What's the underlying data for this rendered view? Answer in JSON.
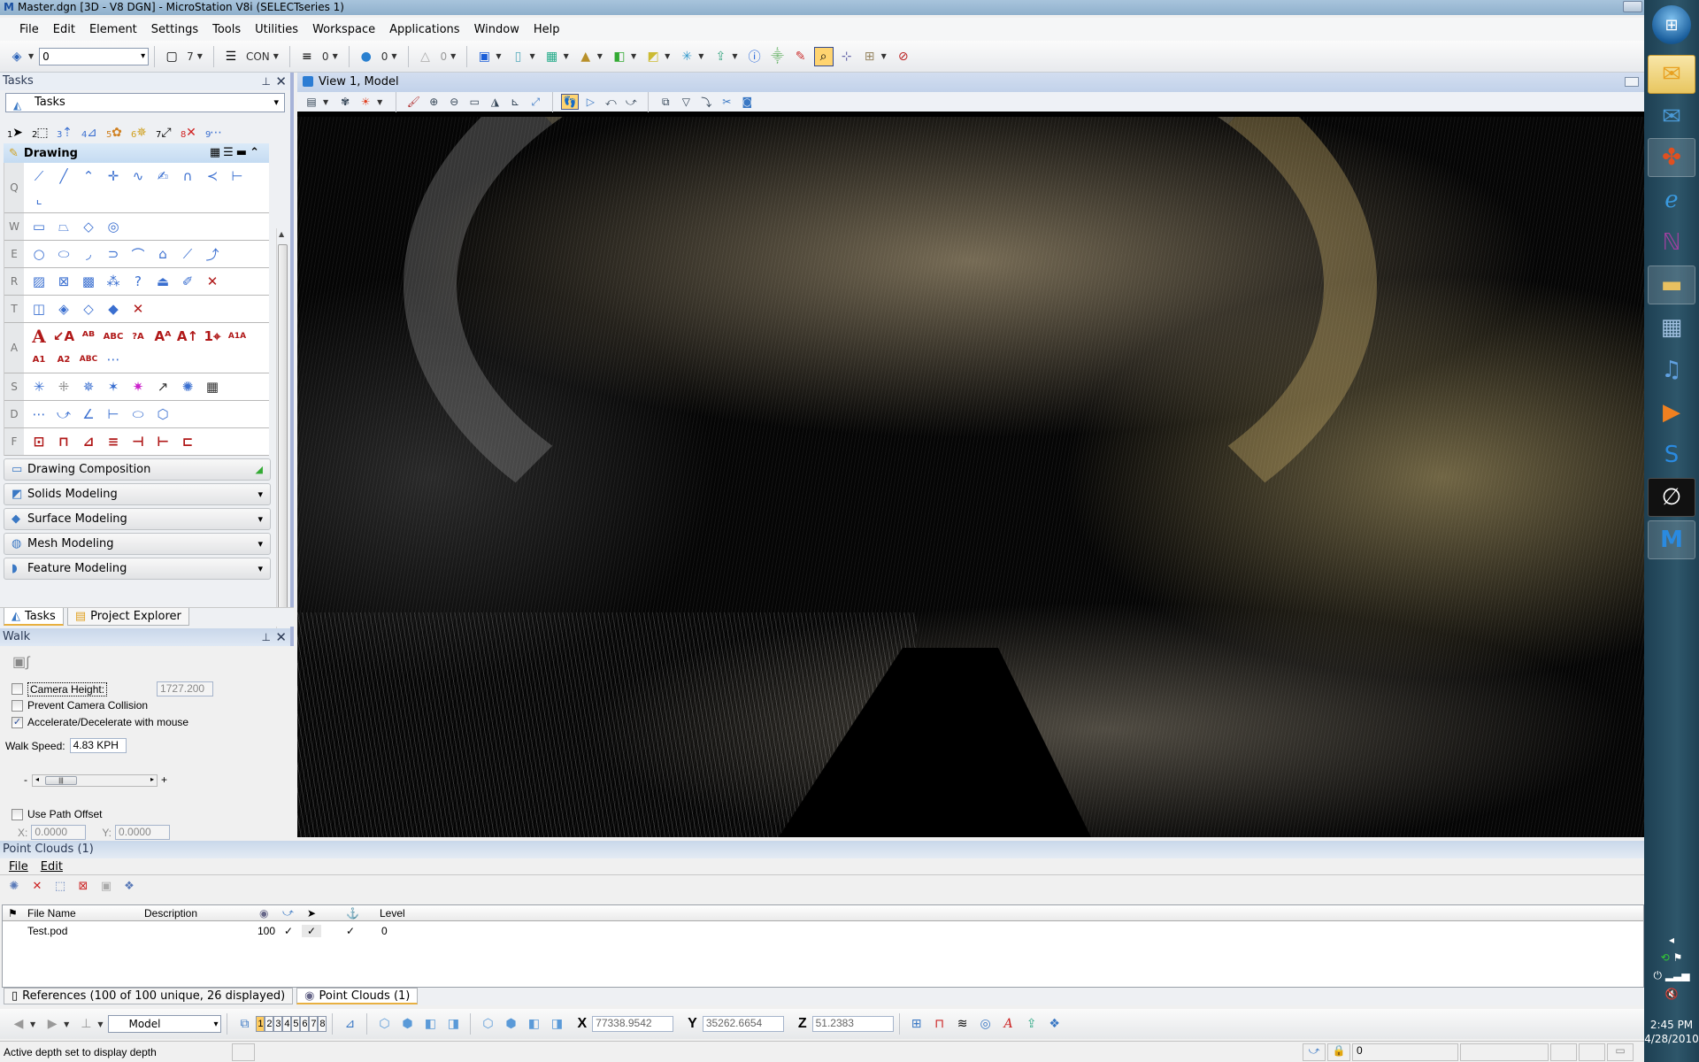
{
  "window": {
    "title": "Master.dgn [3D - V8 DGN] - MicroStation V8i (SELECTseries 1)"
  },
  "menu": [
    "File",
    "Edit",
    "Element",
    "Settings",
    "Tools",
    "Utilities",
    "Workspace",
    "Applications",
    "Window",
    "Help"
  ],
  "attributes_toolbar": {
    "active_level": "0",
    "color_value": "7",
    "line_style_value": "CON",
    "line_weight_value": "0",
    "transparency_value": "0",
    "priority_value": "0"
  },
  "tasks_panel": {
    "title": "Tasks",
    "combo_value": "Tasks",
    "quick_tools": [
      "1",
      "2",
      "3",
      "4",
      "5",
      "6",
      "7",
      "8",
      "9"
    ],
    "drawing_header": "Drawing",
    "row_keys": [
      "Q",
      "W",
      "E",
      "R",
      "T",
      "A",
      "S",
      "D",
      "F"
    ],
    "categories": [
      {
        "label": "Drawing Composition",
        "icon": "drawing-composition-icon"
      },
      {
        "label": "Solids Modeling",
        "icon": "solids-modeling-icon"
      },
      {
        "label": "Surface Modeling",
        "icon": "surface-modeling-icon"
      },
      {
        "label": "Mesh Modeling",
        "icon": "mesh-modeling-icon"
      },
      {
        "label": "Feature Modeling",
        "icon": "feature-modeling-icon"
      }
    ],
    "tabs": [
      {
        "label": "Tasks",
        "active": true
      },
      {
        "label": "Project Explorer",
        "active": false
      }
    ]
  },
  "walk_panel": {
    "title": "Walk",
    "camera_height_label": "Camera Height:",
    "camera_height_checked": false,
    "camera_height_value": "1727.200",
    "prevent_collision_label": "Prevent Camera Collision",
    "prevent_collision_checked": false,
    "accelerate_label": "Accelerate/Decelerate with mouse",
    "accelerate_checked": true,
    "walk_speed_label": "Walk Speed:",
    "walk_speed_value": "4.83 KPH",
    "slider_minus": "-",
    "slider_plus": "+",
    "path_offset_label": "Use Path Offset",
    "path_offset_checked": false,
    "x_label": "X:",
    "x_value": "0.0000",
    "y_label": "Y:",
    "y_value": "0.0000"
  },
  "view": {
    "title": "View 1, Model"
  },
  "point_clouds_panel": {
    "title": "Point Clouds (1)",
    "menu": [
      "File",
      "Edit"
    ],
    "columns": [
      "File Name",
      "Description",
      "",
      "",
      "",
      "",
      "Level"
    ],
    "rows": [
      {
        "file_name": "Test.pod",
        "description": "",
        "density": "100",
        "col_snap": "✓",
        "col_locate": "✓",
        "col_anchor": "✓",
        "level": "0"
      }
    ]
  },
  "bottom_tabs": [
    {
      "label": "References (100 of 100 unique, 26 displayed)",
      "active": false
    },
    {
      "label": "Point Clouds (1)",
      "active": true
    }
  ],
  "view_control": {
    "model_value": "Model",
    "view_numbers": [
      "1",
      "2",
      "3",
      "4",
      "5",
      "6",
      "7",
      "8"
    ],
    "active_view": "1"
  },
  "coordinates": {
    "x_label": "X",
    "x": "77338.9542",
    "y_label": "Y",
    "y": "35262.6654",
    "z_label": "Z",
    "z": "51.2383"
  },
  "status": {
    "message": "Active depth set to display depth",
    "level_value": "0"
  },
  "taskbar": {
    "apps": [
      "Outlook",
      "Windows Mail",
      "Media Center",
      "Internet Explorer",
      "OneNote",
      "Windows Explorer",
      "Calculator",
      "iTunes",
      "Media Player",
      "Skype",
      "Autodesk",
      "MicroStation"
    ],
    "active_app": "Outlook",
    "time": "2:45 PM",
    "date": "4/28/2010"
  }
}
